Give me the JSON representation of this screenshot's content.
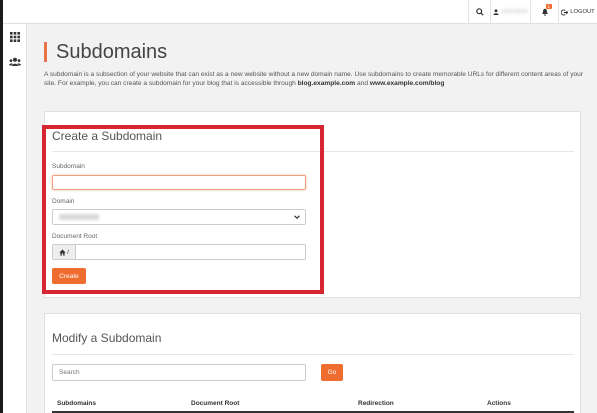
{
  "topbar": {
    "username_blurred": "username",
    "notification_count": "1",
    "logout_label": "LOGOUT"
  },
  "page": {
    "title": "Subdomains",
    "intro_text": "A subdomain is a subsection of your website that can exist as a new website without a new domain name. Use subdomains to create memorable URLs for different content areas of your site. For example, you can create a subdomain for your blog that is accessible through ",
    "intro_example1": "blog.example.com",
    "intro_and": " and ",
    "intro_example2": "www.example.com/blog"
  },
  "create": {
    "title": "Create a Subdomain",
    "subdomain_label": "Subdomain",
    "subdomain_value": "",
    "domain_label": "Domain",
    "docroot_label": "Document Root",
    "docroot_prefix": "/",
    "docroot_value": "",
    "create_button": "Create"
  },
  "modify": {
    "title": "Modify a Subdomain",
    "search_placeholder": "Search",
    "go_button": "Go",
    "columns": [
      "Subdomains",
      "Document Root",
      "Redirection",
      "Actions"
    ]
  },
  "colors": {
    "accent": "#ef6c2f",
    "highlight_box": "#d62631"
  }
}
